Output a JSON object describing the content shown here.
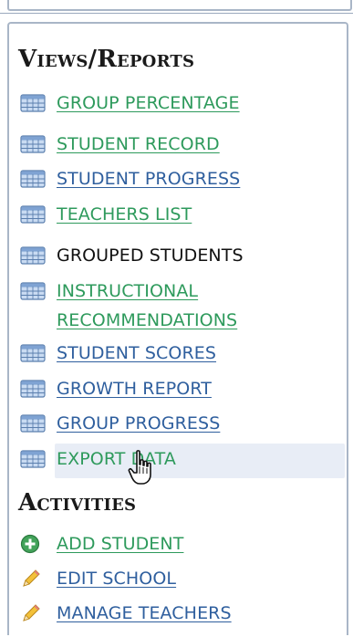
{
  "views_reports": {
    "title": "Views/Reports",
    "items": [
      {
        "label": "GROUP PERCENTAGE",
        "style": "link-green"
      },
      {
        "label": "STUDENT RECORD",
        "style": "link-green"
      },
      {
        "label": "STUDENT PROGRESS",
        "style": "link-blue"
      },
      {
        "label": "TEACHERS LIST",
        "style": "link-green"
      },
      {
        "label": "GROUPED STUDENTS",
        "style": "plain"
      },
      {
        "label": "INSTRUCTIONAL",
        "style": "link-green"
      },
      {
        "label": "RECOMMENDATIONS",
        "style": "link-green"
      },
      {
        "label": "STUDENT SCORES",
        "style": "link-blue"
      },
      {
        "label": "GROWTH REPORT",
        "style": "link-blue"
      },
      {
        "label": "GROUP PROGRESS",
        "style": "link-blue"
      },
      {
        "label": "EXPORT DATA",
        "style": "plain-green"
      }
    ]
  },
  "activities": {
    "title": "Activities",
    "items": [
      {
        "label": "ADD STUDENT",
        "icon": "add-icon"
      },
      {
        "label": "EDIT SCHOOL",
        "icon": "pencil-icon"
      },
      {
        "label": "MANAGE TEACHERS",
        "icon": "pencil-icon"
      }
    ]
  },
  "colors": {
    "link_green": "#2e9a5c",
    "link_blue": "#2f5f9e",
    "hover_bg": "#e8edf6",
    "panel_border": "#a9b6c7"
  }
}
